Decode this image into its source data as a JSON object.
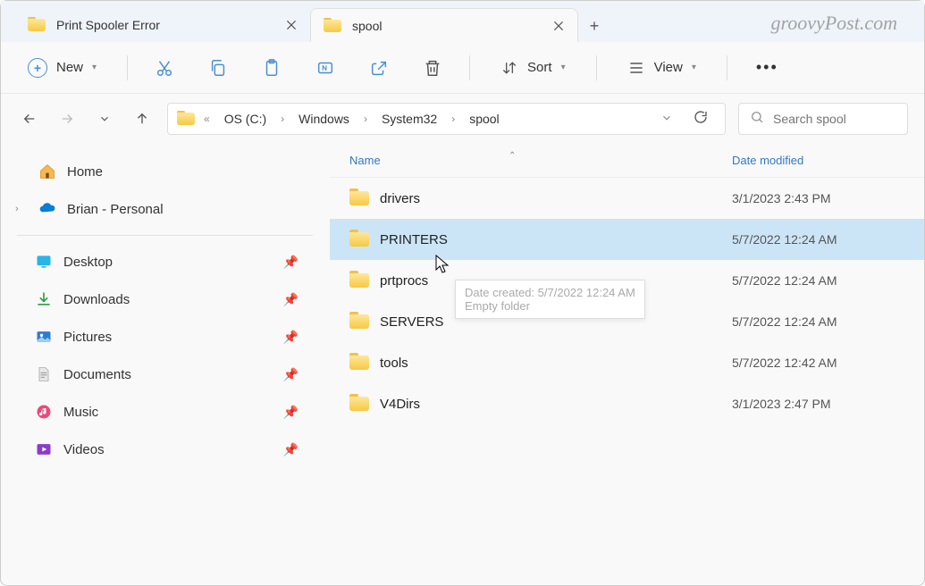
{
  "tabs": [
    {
      "title": "Print Spooler Error",
      "active": false
    },
    {
      "title": "spool",
      "active": true
    }
  ],
  "watermark": "groovyPost.com",
  "toolbar": {
    "new_label": "New",
    "sort_label": "Sort",
    "view_label": "View"
  },
  "breadcrumbs": [
    "OS (C:)",
    "Windows",
    "System32",
    "spool"
  ],
  "search": {
    "placeholder": "Search spool"
  },
  "sidebar": {
    "home": {
      "label": "Home"
    },
    "personal": {
      "label": "Brian - Personal"
    },
    "quick": [
      {
        "label": "Desktop",
        "icon": "desktop"
      },
      {
        "label": "Downloads",
        "icon": "downloads"
      },
      {
        "label": "Pictures",
        "icon": "pictures"
      },
      {
        "label": "Documents",
        "icon": "documents"
      },
      {
        "label": "Music",
        "icon": "music"
      },
      {
        "label": "Videos",
        "icon": "videos"
      }
    ]
  },
  "columns": {
    "name": "Name",
    "date": "Date modified"
  },
  "files": [
    {
      "name": "drivers",
      "date": "3/1/2023 2:43 PM",
      "selected": false
    },
    {
      "name": "PRINTERS",
      "date": "5/7/2022 12:24 AM",
      "selected": true
    },
    {
      "name": "prtprocs",
      "date": "5/7/2022 12:24 AM",
      "selected": false
    },
    {
      "name": "SERVERS",
      "date": "5/7/2022 12:24 AM",
      "selected": false
    },
    {
      "name": "tools",
      "date": "5/7/2022 12:42 AM",
      "selected": false
    },
    {
      "name": "V4Dirs",
      "date": "3/1/2023 2:47 PM",
      "selected": false
    }
  ],
  "tooltip": {
    "line1": "Date created: 5/7/2022 12:24 AM",
    "line2": "Empty folder"
  }
}
